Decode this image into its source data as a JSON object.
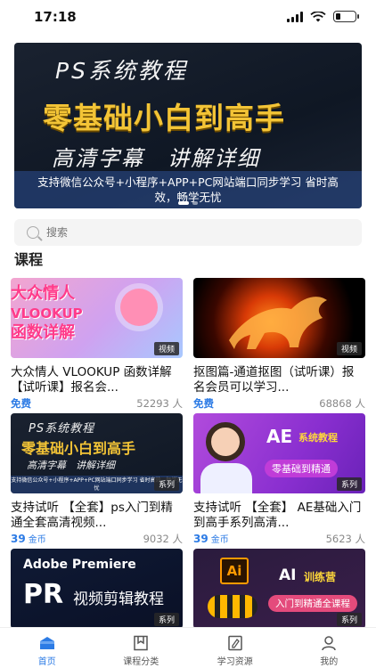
{
  "status": {
    "time": "17:18"
  },
  "banner": {
    "title": "PS系统教程",
    "headline": "零基础小白到高手",
    "subtitle": "高清字幕　讲解详细",
    "strip": "支持微信公众号+小程序+APP+PC网站端口同步学习 省时高效，畅学无忧"
  },
  "search": {
    "placeholder": "搜索"
  },
  "section": {
    "title": "课程"
  },
  "courses": [
    {
      "title": "大众情人 VLOOKUP 函数详解【试听课】报名会...",
      "tag": "视频",
      "price": "免费",
      "learners": "52293 人",
      "thumb_text": [
        "大众情人",
        "VLOOKUP",
        "函数详解"
      ]
    },
    {
      "title": "抠图篇-通道抠图（试听课）报名会员可以学习...",
      "tag": "视频",
      "price": "免费",
      "learners": "68868 人"
    },
    {
      "title": "支持试听 【全套】ps入门到精通全套高清视频...",
      "tag": "系列",
      "price": "39",
      "unit": "金币",
      "learners": "9032 人",
      "thumb_text": [
        "PS系统教程",
        "零基础小白到高手",
        "高清字幕　讲解详细",
        "支持微信公众号+小程序+APP+PC网站端口同步学习 省时高效，畅学无忧"
      ]
    },
    {
      "title": "支持试听 【全套】 AE基础入门到高手系列高清...",
      "tag": "系列",
      "price": "39",
      "unit": "金币",
      "learners": "5623 人",
      "thumb_text": [
        "AE",
        "系统教程",
        "零基础到精通"
      ]
    },
    {
      "title": "",
      "tag": "系列",
      "thumb_text": [
        "Adobe Premiere",
        "PR",
        "视频剪辑教程"
      ]
    },
    {
      "title": "",
      "tag": "系列",
      "thumb_text": [
        "Ai",
        "AI",
        "训练营",
        "入门到精通全课程"
      ]
    }
  ],
  "tabs": [
    {
      "label": "首页",
      "icon": "home-icon",
      "active": true
    },
    {
      "label": "课程分类",
      "icon": "bookmark-icon",
      "active": false
    },
    {
      "label": "学习资源",
      "icon": "resource-icon",
      "active": false
    },
    {
      "label": "我的",
      "icon": "user-icon",
      "active": false
    }
  ],
  "colors": {
    "accent": "#2c7be5",
    "banner_gold": "#f3c436"
  }
}
